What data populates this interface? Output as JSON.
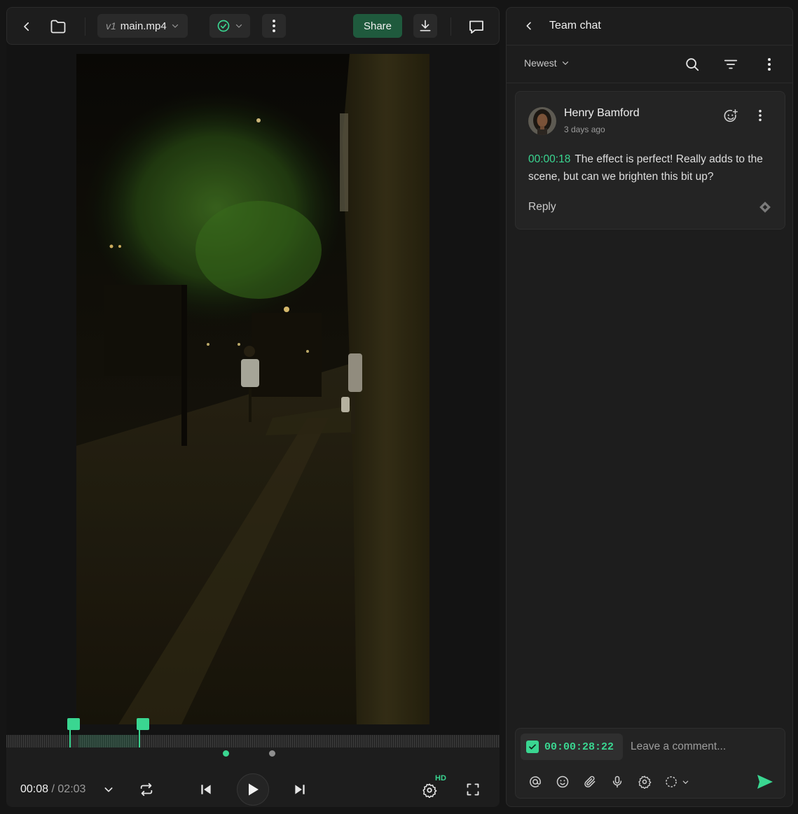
{
  "player": {
    "file": {
      "version": "v1",
      "name": "main.mp4"
    },
    "share_label": "Share",
    "time": {
      "current": "00:08",
      "separator": "/",
      "total": "02:03"
    },
    "quality_badge": "HD",
    "markers_count_hint": 2
  },
  "chat": {
    "title": "Team chat",
    "sort_label": "Newest",
    "comment": {
      "author": "Henry Bamford",
      "time_ago": "3 days ago",
      "timestamp": "00:00:18",
      "text": "The effect is perfect! Really adds to the scene, but can we brighten this bit up?",
      "reply_label": "Reply"
    },
    "composer": {
      "timecode": "00:00:28:22",
      "placeholder": "Leave a comment...",
      "timecode_checked": true
    }
  },
  "colors": {
    "accent": "#3ad691",
    "share_bg": "#1f5a3d",
    "panel": "#1d1d1d",
    "background": "#151515"
  }
}
